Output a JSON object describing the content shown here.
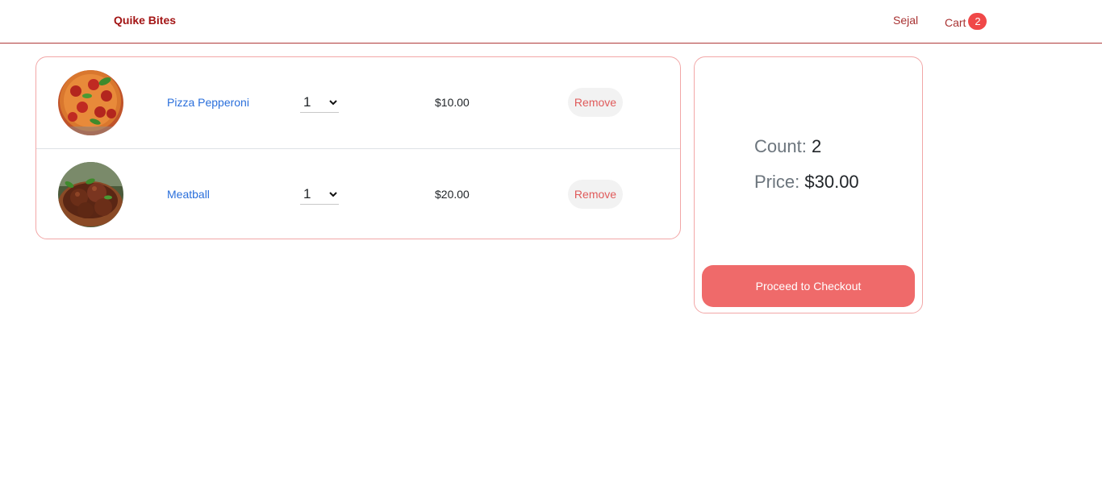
{
  "nav": {
    "brand": "Quike Bites",
    "user": "Sejal",
    "cart_label": "Cart",
    "cart_count": "2"
  },
  "cart": {
    "items": [
      {
        "name": "Pizza Pepperoni",
        "quantity": "1",
        "price": "$10.00",
        "remove_label": "Remove",
        "image_icon": "pizza-image"
      },
      {
        "name": "Meatball",
        "quantity": "1",
        "price": "$20.00",
        "remove_label": "Remove",
        "image_icon": "meatball-image"
      }
    ]
  },
  "summary": {
    "count_label": "Count:",
    "count_value": "2",
    "price_label": "Price:",
    "price_value": "$30.00",
    "checkout_label": "Proceed to Checkout"
  },
  "colors": {
    "brand": "#a31515",
    "accent": "#ef6a6a",
    "badge": "#f04848",
    "link": "#2a6fdb",
    "border": "#f2a7a7"
  }
}
